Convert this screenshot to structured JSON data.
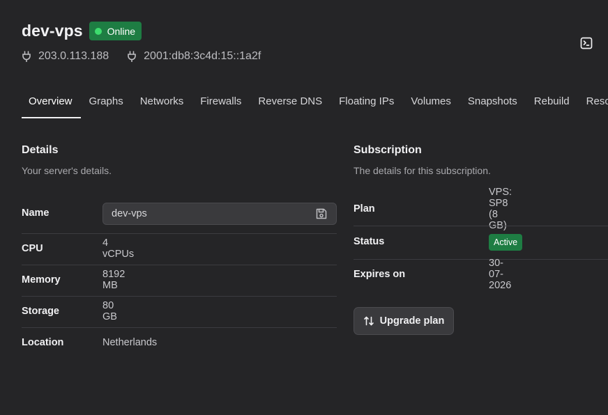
{
  "server": {
    "name": "dev-vps",
    "status": "Online",
    "ipv4": "203.0.113.188",
    "ipv6": "2001:db8:3c4d:15::1a2f"
  },
  "tabs": [
    {
      "label": "Overview",
      "active": true
    },
    {
      "label": "Graphs"
    },
    {
      "label": "Networks"
    },
    {
      "label": "Firewalls"
    },
    {
      "label": "Reverse DNS"
    },
    {
      "label": "Floating IPs"
    },
    {
      "label": "Volumes"
    },
    {
      "label": "Snapshots"
    },
    {
      "label": "Rebuild"
    },
    {
      "label": "Rescue"
    }
  ],
  "details": {
    "title": "Details",
    "subtitle": "Your server's details.",
    "name_label": "Name",
    "name_value": "dev-vps",
    "cpu_label": "CPU",
    "cpu_value": "4 vCPUs",
    "memory_label": "Memory",
    "memory_value": "8192 MB",
    "storage_label": "Storage",
    "storage_value": "80 GB",
    "location_label": "Location",
    "location_value": "Netherlands"
  },
  "subscription": {
    "title": "Subscription",
    "subtitle": "The details for this subscription.",
    "plan_label": "Plan",
    "plan_value": "VPS: SP8 (8 GB)",
    "status_label": "Status",
    "status_value": "Active",
    "expires_label": "Expires on",
    "expires_value": "30-07-2026",
    "upgrade_label": "Upgrade plan"
  },
  "icons": {
    "ip": "plug-icon",
    "console": "terminal-icon",
    "save": "save-icon",
    "upgrade": "arrows-up-down-icon"
  },
  "colors": {
    "background": "#252527",
    "status_green": "#1e7d43",
    "status_dot": "#3ddc6e"
  }
}
